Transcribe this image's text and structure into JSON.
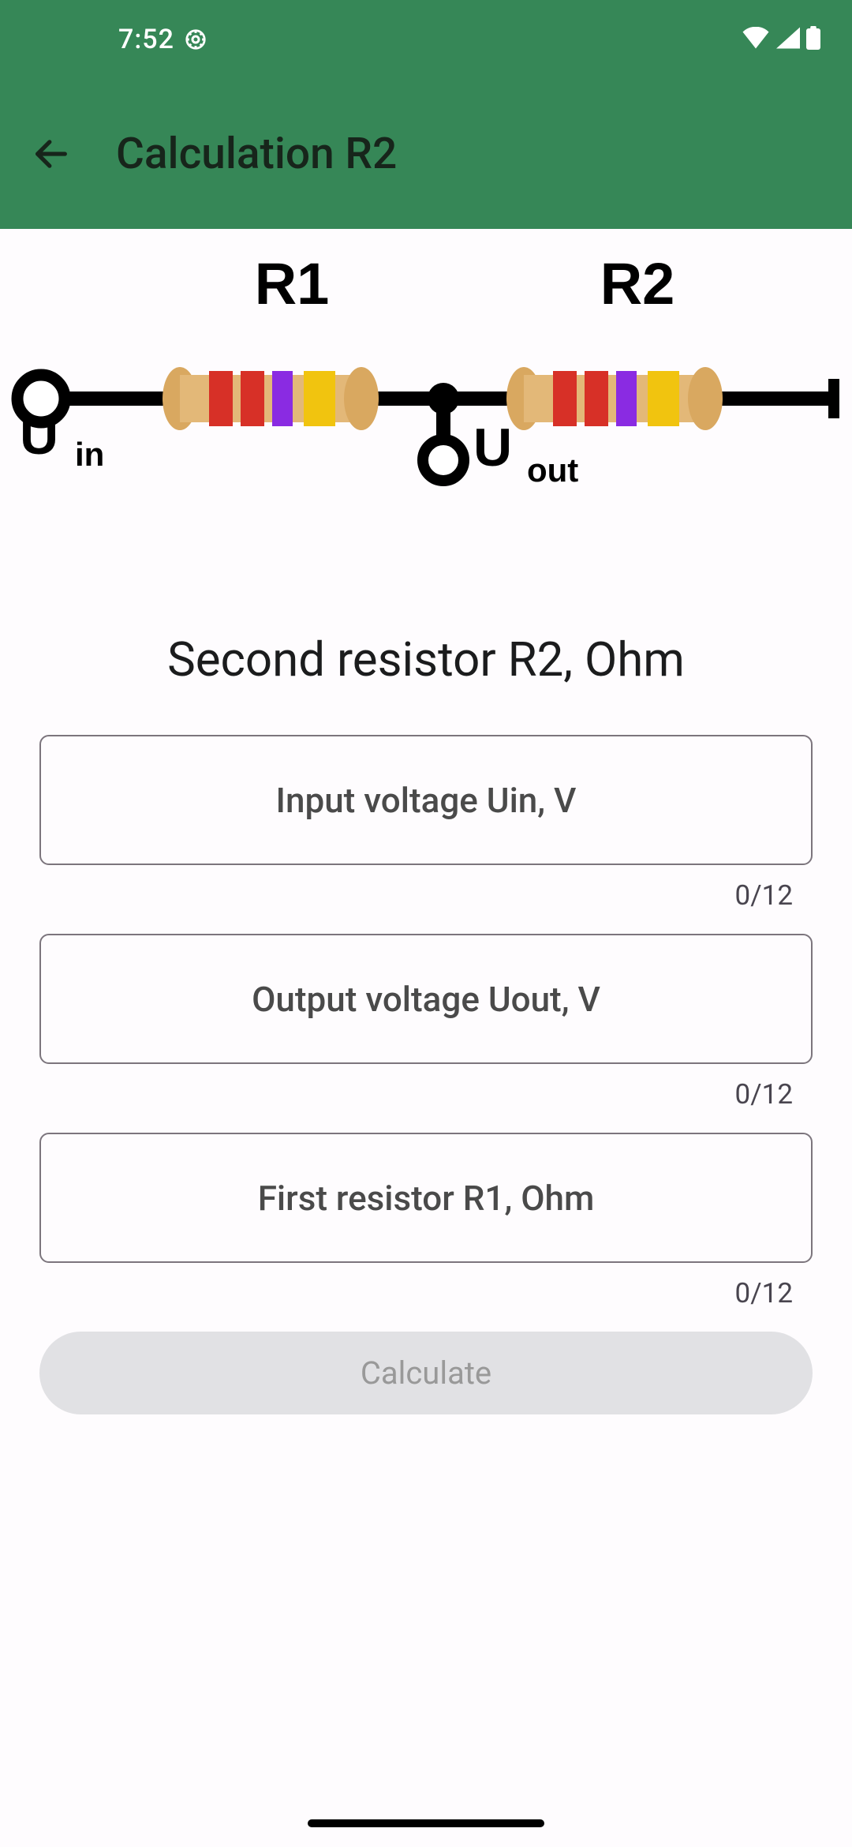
{
  "status_bar": {
    "time": "7:52"
  },
  "app_bar": {
    "title": "Calculation R2"
  },
  "diagram": {
    "r1_label": "R1",
    "r2_label": "R2",
    "uin_label_main": "U",
    "uin_label_sub": "in",
    "uout_label_main": "U",
    "uout_label_sub": "out"
  },
  "form": {
    "title": "Second resistor R2, Ohm",
    "fields": [
      {
        "placeholder": "Input voltage Uin, V",
        "counter": "0/12"
      },
      {
        "placeholder": "Output voltage Uout, V",
        "counter": "0/12"
      },
      {
        "placeholder": "First resistor R1, Ohm",
        "counter": "0/12"
      }
    ],
    "button_label": "Calculate"
  }
}
